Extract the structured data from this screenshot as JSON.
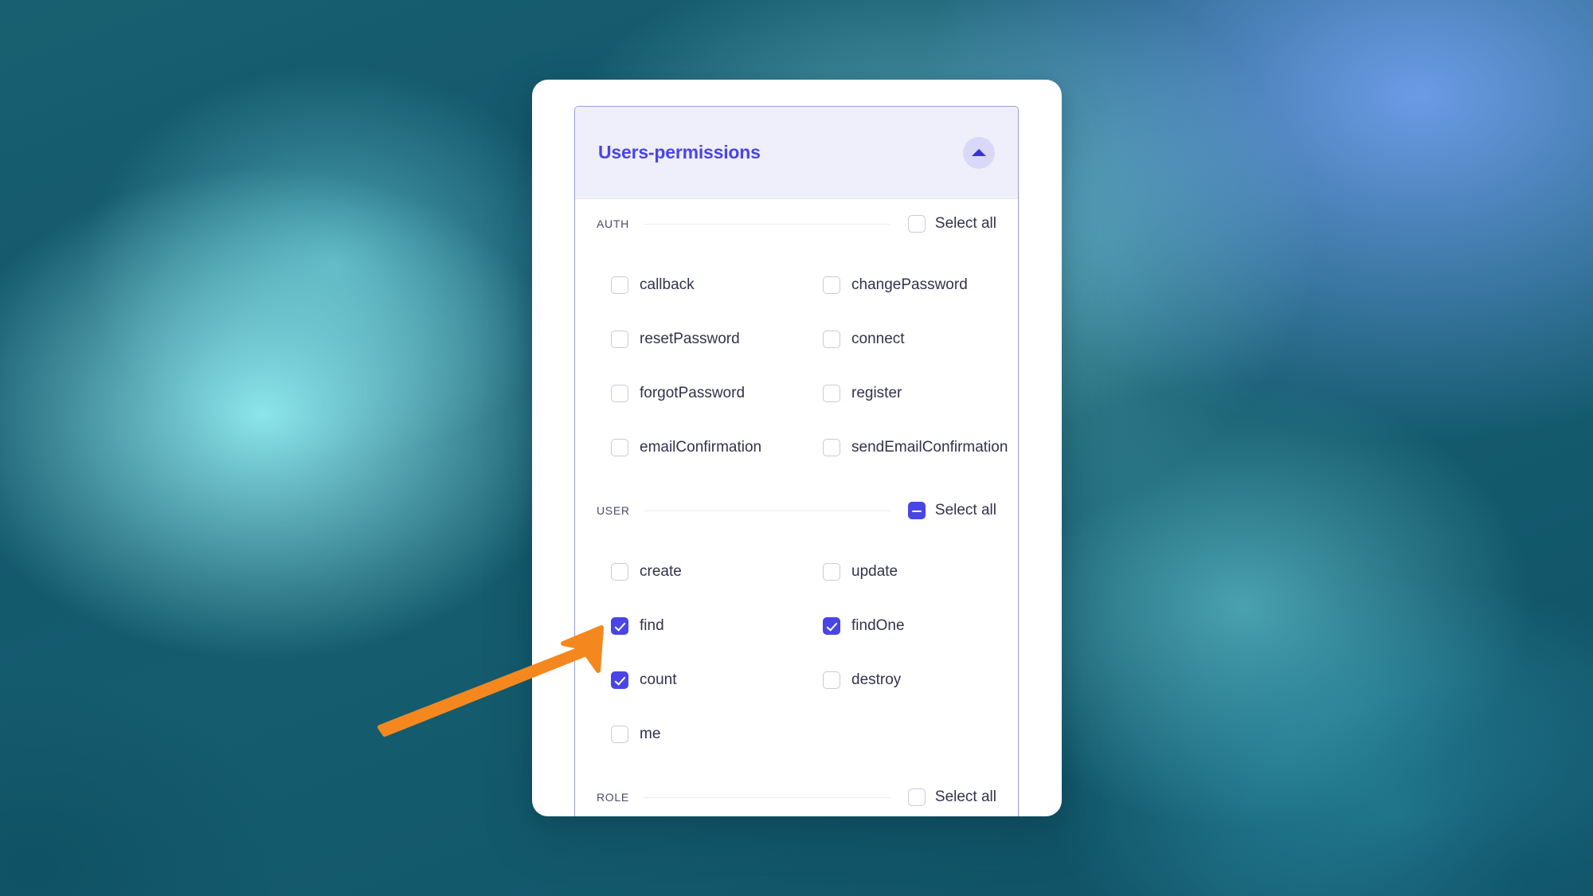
{
  "theme": {
    "accent": "#4945E4",
    "title_color": "#4A45E2",
    "header_bg": "#EFEFFB",
    "panel_border": "#9a9ad8",
    "text_color": "#32324D",
    "section_label_color": "#4A4A6A",
    "annotation_color": "#F5871F",
    "wallpaper_teal": "#14556B",
    "wallpaper_blue": "#709EEC",
    "wallpaper_cyan": "#96F0F5"
  },
  "panel": {
    "title": "Users-permissions",
    "collapse_icon": "chevron-up-icon",
    "sections": [
      {
        "id": "auth",
        "label": "AUTH",
        "select_all_label": "Select all",
        "select_all_state": "unchecked",
        "items": [
          {
            "label": "callback",
            "checked": false
          },
          {
            "label": "changePassword",
            "checked": false
          },
          {
            "label": "resetPassword",
            "checked": false
          },
          {
            "label": "connect",
            "checked": false
          },
          {
            "label": "forgotPassword",
            "checked": false
          },
          {
            "label": "register",
            "checked": false
          },
          {
            "label": "emailConfirmation",
            "checked": false
          },
          {
            "label": "sendEmailConfirmation",
            "checked": false
          }
        ]
      },
      {
        "id": "user",
        "label": "USER",
        "select_all_label": "Select all",
        "select_all_state": "indeterminate",
        "items": [
          {
            "label": "create",
            "checked": false
          },
          {
            "label": "update",
            "checked": false
          },
          {
            "label": "find",
            "checked": true
          },
          {
            "label": "findOne",
            "checked": true
          },
          {
            "label": "count",
            "checked": true
          },
          {
            "label": "destroy",
            "checked": false
          },
          {
            "label": "me",
            "checked": false
          }
        ]
      },
      {
        "id": "role",
        "label": "ROLE",
        "select_all_label": "Select all",
        "select_all_state": "unchecked",
        "items": []
      }
    ]
  },
  "annotation": {
    "type": "arrow",
    "color": "#F5871F",
    "points_to": "find-checkbox"
  }
}
